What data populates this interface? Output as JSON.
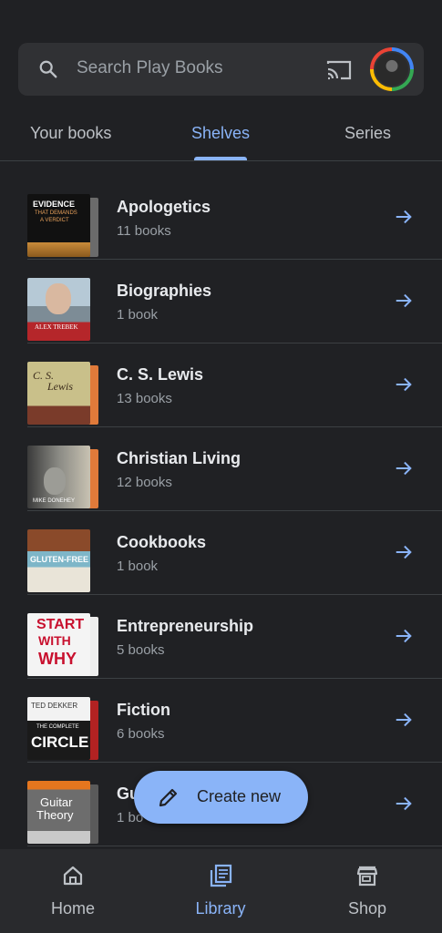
{
  "search": {
    "placeholder": "Search Play Books"
  },
  "tabs": [
    {
      "label": "Your books",
      "active": false
    },
    {
      "label": "Shelves",
      "active": true
    },
    {
      "label": "Series",
      "active": false
    }
  ],
  "shelves": [
    {
      "title": "Apologetics",
      "count": "11 books",
      "cover_text": [
        "EVIDENCE",
        "THAT DEMANDS",
        "A VERDICT"
      ]
    },
    {
      "title": "Biographies",
      "count": "1 book",
      "cover_text": [
        "ALEX TREBEK"
      ]
    },
    {
      "title": "C. S. Lewis",
      "count": "13 books",
      "cover_text": [
        "C. S.",
        "Lewis"
      ]
    },
    {
      "title": "Christian Living",
      "count": "12 books",
      "cover_text": [
        "MIKE DONEHEY"
      ]
    },
    {
      "title": "Cookbooks",
      "count": "1 book",
      "cover_text": [
        "GLUTEN-FREE"
      ]
    },
    {
      "title": "Entrepreneurship",
      "count": "5 books",
      "cover_text": [
        "START",
        "WITH",
        "WHY"
      ]
    },
    {
      "title": "Fiction",
      "count": "6 books",
      "cover_text": [
        "TED DEKKER",
        "THE COMPLETE",
        "CIRCLE"
      ]
    },
    {
      "title": "Gu",
      "count": "1 bo",
      "cover_text": [
        "Guitar",
        "Theory"
      ]
    }
  ],
  "fab": {
    "label": "Create new"
  },
  "nav": [
    {
      "label": "Home",
      "icon": "home-icon",
      "active": false
    },
    {
      "label": "Library",
      "icon": "library-icon",
      "active": true
    },
    {
      "label": "Shop",
      "icon": "store-icon",
      "active": false
    }
  ],
  "colors": {
    "accent": "#8ab4f8",
    "background": "#202124",
    "surface": "#303134"
  }
}
